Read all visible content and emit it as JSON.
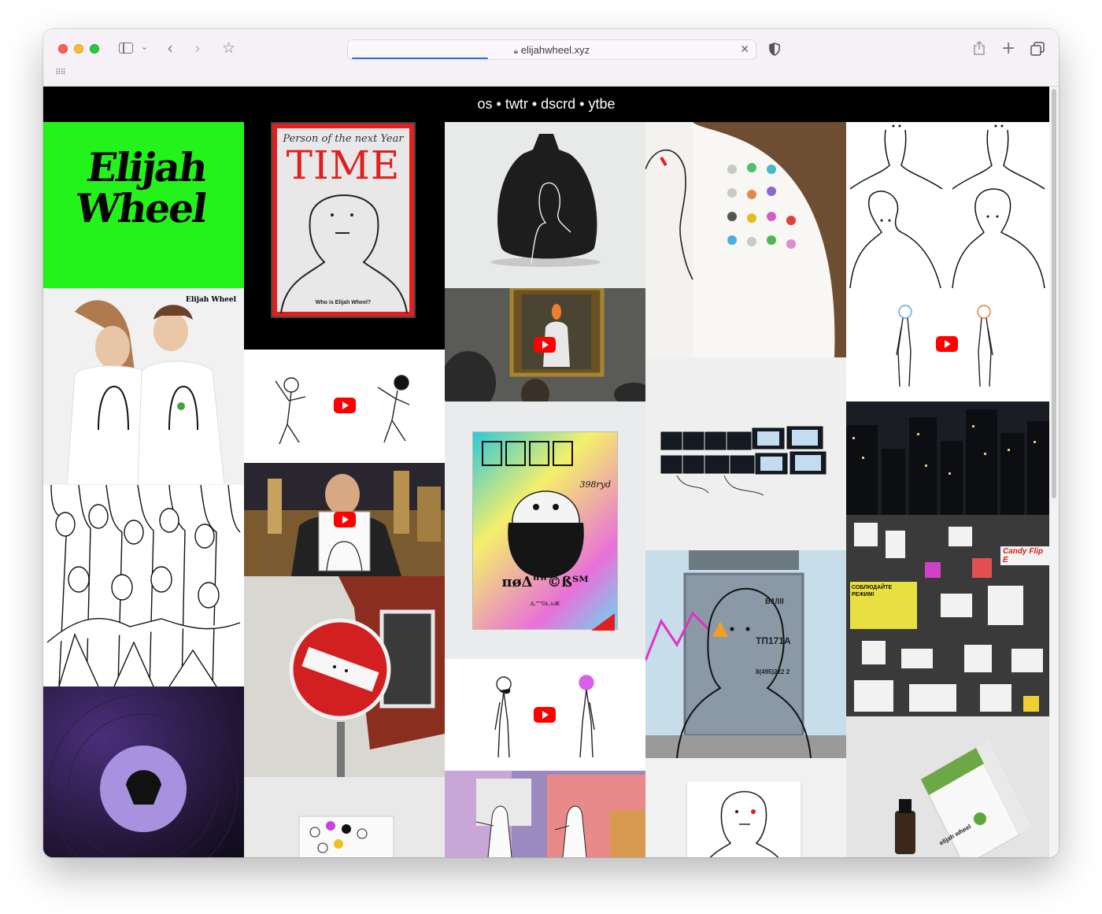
{
  "browser": {
    "url": "elijahwheel.xyz",
    "load_progress_percent": 34
  },
  "site": {
    "nav": {
      "links": [
        "os",
        "twtr",
        "dscrd",
        "ytbe"
      ],
      "separator": "•"
    },
    "logo_text": "Elijah Wheel",
    "magazine": {
      "header": "Person of the next Year",
      "masthead": "TIME",
      "caption": "Who is Elijah Wheel?"
    },
    "poster": {
      "title": "πøΔ\"\"©ßᵀᴹ",
      "price": "398ryd",
      "subtitle": "Δ,\"\"\"©Ɫ,∪Æ"
    },
    "door": {
      "top_label": "B1/III",
      "mid_label": "ТП171А",
      "bottom_label": "8(495)222 2"
    },
    "street": {
      "sign_banner": "СОБЛЮДАЙТЕ РЕЖИМ!",
      "sticker": "Candy Flip E"
    },
    "product": {
      "box_brand": "elijah wheel"
    }
  },
  "colors": {
    "accent_green": "#23f31a",
    "youtube_red": "#ff0000",
    "nav_bg": "#000000",
    "time_red": "#e02020"
  }
}
